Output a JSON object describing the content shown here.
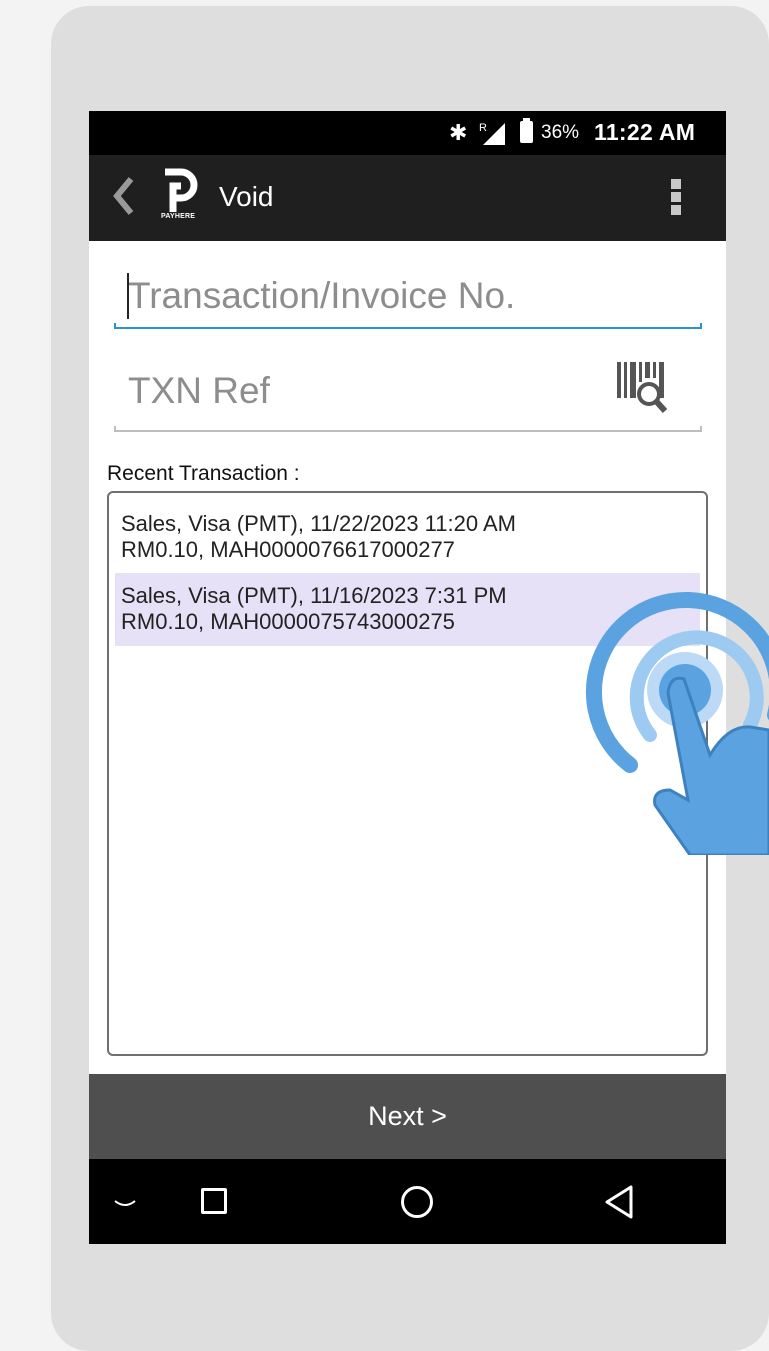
{
  "status_bar": {
    "bluetooth_icon": "bluetooth-icon",
    "signal_indicator": "R",
    "battery_percent": "36%",
    "time": "11:22 AM"
  },
  "app_bar": {
    "title": "Void",
    "logo_text": "PAYHERE"
  },
  "form": {
    "transaction_placeholder": "Transaction/Invoice No.",
    "txn_ref_placeholder": "TXN Ref"
  },
  "recent": {
    "label": "Recent Transaction :",
    "items": [
      {
        "line1": "Sales, Visa (PMT), 11/22/2023 11:20 AM",
        "line2": "RM0.10, MAH0000076617000277"
      },
      {
        "line1": "Sales, Visa (PMT), 11/16/2023 7:31 PM",
        "line2": "RM0.10, MAH0000075743000275"
      }
    ]
  },
  "footer": {
    "next_label": "Next >"
  },
  "colors": {
    "accent": "#2f8fd4",
    "selected_row": "#e6e1f6",
    "app_bar": "#1f1f1f",
    "next_bar": "#4f4f4f",
    "tap_icon": "#5aa3e0"
  }
}
